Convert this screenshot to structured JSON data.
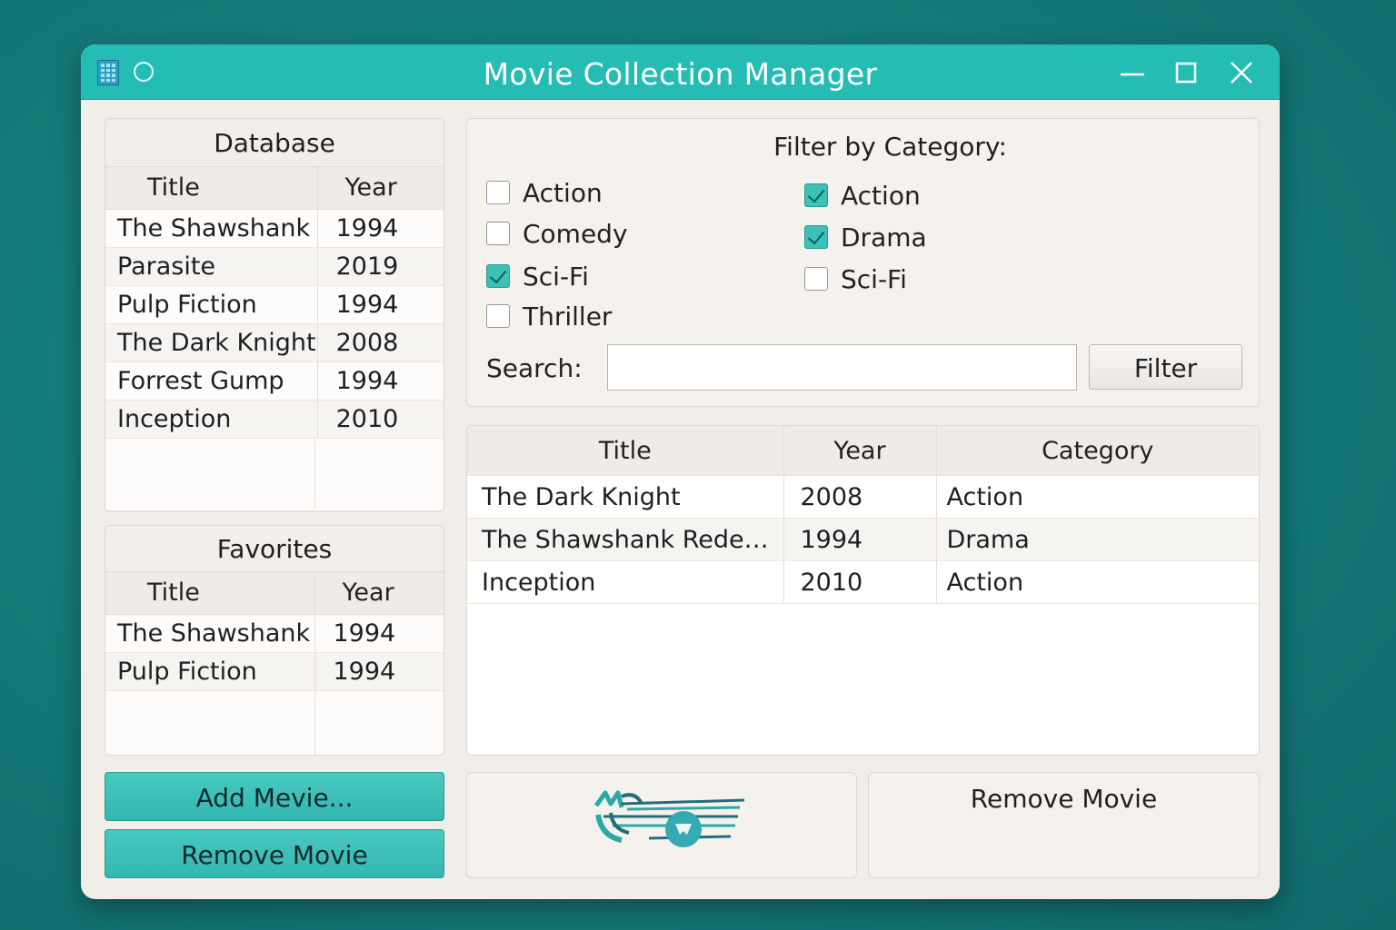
{
  "window": {
    "title": "Movie Collection Manager"
  },
  "database": {
    "heading": "Database",
    "columns": [
      "Title",
      "Year"
    ],
    "rows": [
      {
        "title": "The Shawshank",
        "year": "1994"
      },
      {
        "title": "Parasite",
        "year": "2019"
      },
      {
        "title": "Pulp Fiction",
        "year": "1994"
      },
      {
        "title": "The Dark Knight",
        "year": "2008"
      },
      {
        "title": "Forrest Gump",
        "year": "1994"
      },
      {
        "title": "Inception",
        "year": "2010"
      }
    ]
  },
  "favorites": {
    "heading": "Favorites",
    "columns": [
      "Title",
      "Year"
    ],
    "rows": [
      {
        "title": "The Shawshank",
        "year": "1994"
      },
      {
        "title": "Pulp Fiction",
        "year": "1994"
      }
    ]
  },
  "buttons": {
    "add_movie": "Add Mevie...",
    "remove_movie": "Remove Movie",
    "remove_movie_panel": "Remove Movie",
    "filter": "Filter"
  },
  "filter": {
    "title": "Filter by Category:",
    "left_options": [
      {
        "label": "Action",
        "checked": false
      },
      {
        "label": "Comedy",
        "checked": false
      },
      {
        "label": "Sci-Fi",
        "checked": true
      },
      {
        "label": "Thriller",
        "checked": false
      }
    ],
    "right_options": [
      {
        "label": "Action",
        "checked": true
      },
      {
        "label": "Drama",
        "checked": true
      },
      {
        "label": "Sci-Fi",
        "checked": false
      }
    ],
    "search_label": "Search:",
    "search_value": "",
    "search_placeholder": ""
  },
  "results": {
    "columns": [
      "Title",
      "Year",
      "Category"
    ],
    "rows": [
      {
        "title": "The Dark Knight",
        "year": "2008",
        "category": "Action"
      },
      {
        "title": "The Shawshank Redempt...",
        "year": "1994",
        "category": "Drama"
      },
      {
        "title": "Inception",
        "year": "2010",
        "category": "Action"
      }
    ]
  },
  "colors": {
    "accent": "#25bcb4",
    "button_teal": "#3cbdb6",
    "background": "#167c79",
    "window_body": "#f1eee9"
  },
  "icons": {
    "app": "app-grid-icon",
    "circle": "circle-icon",
    "minimize": "minimize-icon",
    "maximize": "maximize-icon",
    "close": "close-icon",
    "logo": "movie-logo-icon"
  }
}
